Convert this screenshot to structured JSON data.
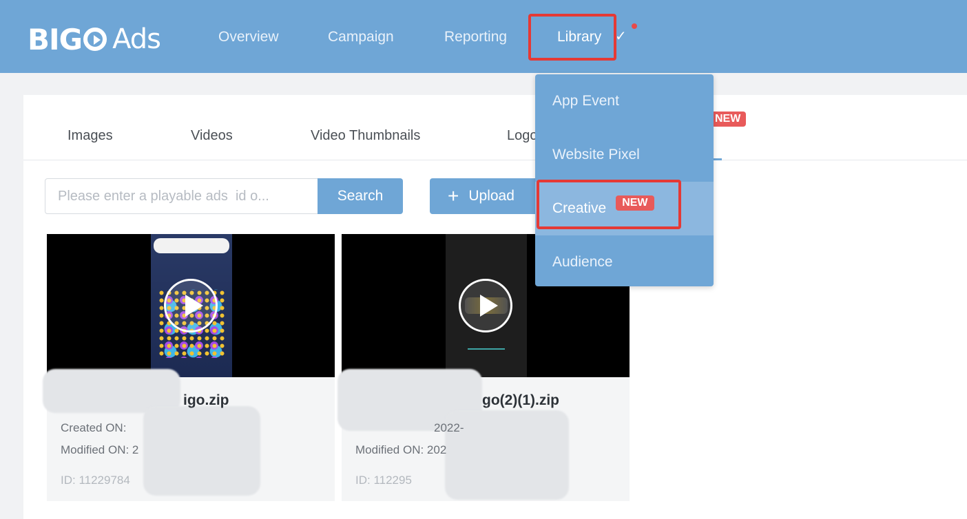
{
  "brand": {
    "name_bold": "BIG",
    "name_rest": "Ads"
  },
  "nav": {
    "items": [
      "Overview",
      "Campaign",
      "Reporting",
      "Library"
    ],
    "library_check": "✓"
  },
  "tabs": {
    "items": [
      "Images",
      "Videos",
      "Video Thumbnails",
      "Logo"
    ],
    "new_badge": "NEW"
  },
  "toolbar": {
    "search_placeholder": "Please enter a playable ads  id o...",
    "search_label": "Search",
    "upload_plus": "+",
    "upload_label": "Upload"
  },
  "cards": [
    {
      "name": "igo.zip",
      "created": "Created ON:",
      "modified": "Modified ON: 2",
      "id": "ID: 11229784"
    },
    {
      "name": "go(2)(1).zip",
      "created": "2022-",
      "modified": "Modified ON: 202",
      "id": "ID: 112295"
    }
  ],
  "dropdown": {
    "items": [
      "App Event",
      "Website Pixel",
      "Creative",
      "Audience"
    ],
    "new_badge": "NEW"
  },
  "colors": {
    "accent": "#6fa6d6",
    "highlight": "#e53935",
    "badge": "#e85a5a"
  }
}
